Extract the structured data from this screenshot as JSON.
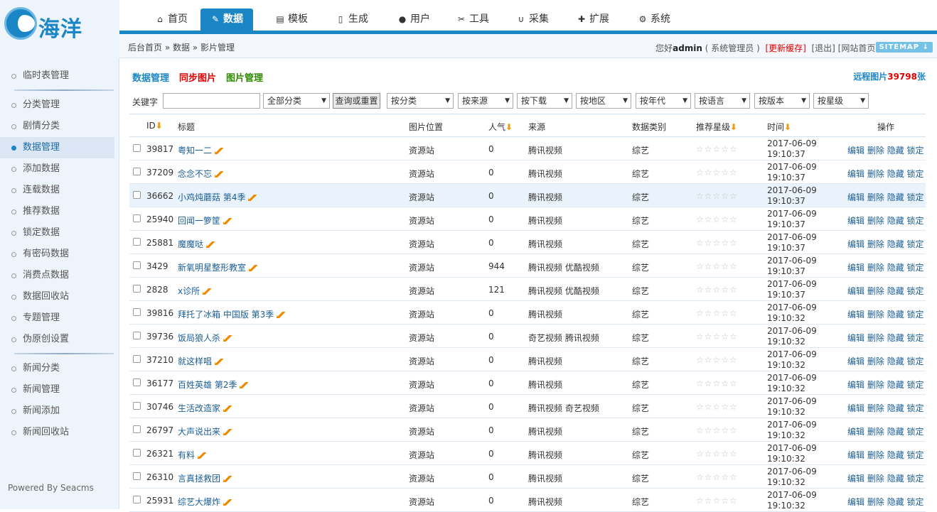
{
  "logo": {
    "text": "海洋"
  },
  "nav": [
    {
      "label": "首页",
      "icon": "home-icon",
      "glyph": "⌂"
    },
    {
      "label": "数据",
      "icon": "edit-icon",
      "glyph": "✎",
      "active": true
    },
    {
      "label": "模板",
      "icon": "file-icon",
      "glyph": "▤"
    },
    {
      "label": "生成",
      "icon": "document-icon",
      "glyph": "▯"
    },
    {
      "label": "用户",
      "icon": "user-icon",
      "glyph": "●"
    },
    {
      "label": "工具",
      "icon": "wrench-icon",
      "glyph": "✂"
    },
    {
      "label": "采集",
      "icon": "magnet-icon",
      "glyph": "∪"
    },
    {
      "label": "扩展",
      "icon": "puzzle-icon",
      "glyph": "✚"
    },
    {
      "label": "系统",
      "icon": "gear-icon",
      "glyph": "⚙"
    }
  ],
  "breadcrumb": "后台首页 » 数据 » 影片管理",
  "user": {
    "greet": "您好",
    "name": "admin",
    "role": "( 系统管理员 )",
    "refresh": "[更新缓存]",
    "links": "[退出] [网站首页]",
    "sitemap": "SITEMAP ↓"
  },
  "sidebar": {
    "group1": [
      "临时表管理"
    ],
    "group2": [
      "分类管理",
      "剧情分类",
      "数据管理",
      "添加数据",
      "连载数据",
      "推荐数据",
      "锁定数据",
      "有密码数据",
      "消费点数据",
      "数据回收站",
      "专题管理",
      "伪原创设置"
    ],
    "group3": [
      "新闻分类",
      "新闻管理",
      "新闻添加",
      "新闻回收站"
    ],
    "active": "数据管理",
    "powered": "Powered By Seacms"
  },
  "tabs": [
    {
      "label": "数据管理",
      "color": "#1b86c6"
    },
    {
      "label": "同步图片",
      "color": "#e10000"
    },
    {
      "label": "图片管理",
      "color": "#2e8b00"
    }
  ],
  "remote": {
    "prefix": "远程图片",
    "count": "3979",
    "num8": "8",
    "suffix": "张"
  },
  "filter": {
    "keyword_label": "关键字",
    "keyword_value": "",
    "category": "全部分类",
    "query_btn": "查询或重置",
    "selects": [
      "按分类",
      "按来源",
      "按下载",
      "按地区",
      "按年代",
      "按语言",
      "按版本",
      "按星级"
    ]
  },
  "columns": {
    "id": "ID",
    "title": "标题",
    "pic": "图片位置",
    "pop": "人气",
    "source": "来源",
    "type": "数据类别",
    "star": "推荐星级",
    "time": "时间",
    "ops": "操作"
  },
  "rows": [
    {
      "id": "39817",
      "title": "粤知一二",
      "pic": "资源站",
      "pop": "0",
      "source": "腾讯视频",
      "type": "综艺",
      "date": "2017-06-09",
      "clock": "19:10:37"
    },
    {
      "id": "37209",
      "title": "念念不忘",
      "pic": "资源站",
      "pop": "0",
      "source": "腾讯视频",
      "type": "综艺",
      "date": "2017-06-09",
      "clock": "19:10:37"
    },
    {
      "id": "36662",
      "title": "小鸡炖蘑菇 第4季",
      "pic": "资源站",
      "pop": "0",
      "source": "腾讯视频",
      "type": "综艺",
      "date": "2017-06-09",
      "clock": "19:10:37",
      "hl": true
    },
    {
      "id": "25940",
      "title": "回闻一箩筐",
      "pic": "资源站",
      "pop": "0",
      "source": "腾讯视频",
      "type": "综艺",
      "date": "2017-06-09",
      "clock": "19:10:37"
    },
    {
      "id": "25881",
      "title": "魔魔哒",
      "pic": "资源站",
      "pop": "0",
      "source": "腾讯视频",
      "type": "综艺",
      "date": "2017-06-09",
      "clock": "19:10:37"
    },
    {
      "id": "3429",
      "title": "新氧明星整形教室",
      "pic": "资源站",
      "pop": "944",
      "source": "腾讯视频 优酷视频",
      "type": "综艺",
      "date": "2017-06-09",
      "clock": "19:10:37"
    },
    {
      "id": "2828",
      "title": "x诊所",
      "pic": "资源站",
      "pop": "121",
      "source": "腾讯视频 优酷视频",
      "type": "综艺",
      "date": "2017-06-09",
      "clock": "19:10:37"
    },
    {
      "id": "39816",
      "title": "拜托了冰箱 中国版 第3季",
      "pic": "资源站",
      "pop": "0",
      "source": "腾讯视频",
      "type": "综艺",
      "date": "2017-06-09",
      "clock": "19:10:32"
    },
    {
      "id": "39736",
      "title": "饭局狼人杀",
      "pic": "资源站",
      "pop": "0",
      "source": "奇艺视频 腾讯视频",
      "type": "综艺",
      "date": "2017-06-09",
      "clock": "19:10:32"
    },
    {
      "id": "37210",
      "title": "就这样唱",
      "pic": "资源站",
      "pop": "0",
      "source": "腾讯视频",
      "type": "综艺",
      "date": "2017-06-09",
      "clock": "19:10:32"
    },
    {
      "id": "36177",
      "title": "百姓英雄 第2季",
      "pic": "资源站",
      "pop": "0",
      "source": "腾讯视频",
      "type": "综艺",
      "date": "2017-06-09",
      "clock": "19:10:32"
    },
    {
      "id": "30746",
      "title": "生活改造家",
      "pic": "资源站",
      "pop": "0",
      "source": "腾讯视频 奇艺视频",
      "type": "综艺",
      "date": "2017-06-09",
      "clock": "19:10:32"
    },
    {
      "id": "26797",
      "title": "大声说出来",
      "pic": "资源站",
      "pop": "0",
      "source": "腾讯视频",
      "type": "综艺",
      "date": "2017-06-09",
      "clock": "19:10:32"
    },
    {
      "id": "26321",
      "title": "有料",
      "pic": "资源站",
      "pop": "0",
      "source": "腾讯视频",
      "type": "综艺",
      "date": "2017-06-09",
      "clock": "19:10:32"
    },
    {
      "id": "26310",
      "title": "言真拯救团",
      "pic": "资源站",
      "pop": "0",
      "source": "腾讯视频",
      "type": "综艺",
      "date": "2017-06-09",
      "clock": "19:10:32"
    },
    {
      "id": "25931",
      "title": "综艺大爆炸",
      "pic": "资源站",
      "pop": "0",
      "source": "腾讯视频",
      "type": "综艺",
      "date": "2017-06-09",
      "clock": "19:10:32"
    }
  ],
  "row_ops": {
    "edit": "编辑",
    "del": "删除",
    "hide": "隐藏",
    "lock": "锁定"
  },
  "stars": "☆☆☆☆☆"
}
